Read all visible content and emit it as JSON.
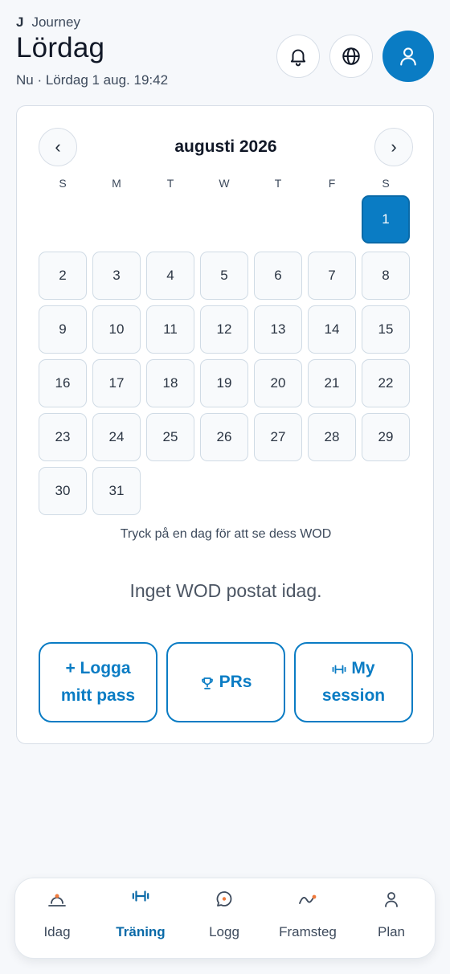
{
  "header": {
    "brand_mark": "J",
    "brand_name": "Journey",
    "title": "Lördag",
    "subtitle": "Nu · Lördag 1 aug. 19:42",
    "icons": {
      "notifications": "bell-icon",
      "language": "globe-icon",
      "profile": "user-icon"
    }
  },
  "calendar": {
    "month_label": "augusti 2026",
    "prev_label": "‹",
    "next_label": "›",
    "weekdays": [
      "S",
      "M",
      "T",
      "W",
      "T",
      "F",
      "S"
    ],
    "days": [
      "1",
      "2",
      "3",
      "4",
      "5",
      "6",
      "7",
      "8",
      "9",
      "10",
      "11",
      "12",
      "13",
      "14",
      "15",
      "16",
      "17",
      "18",
      "19",
      "20",
      "21",
      "22",
      "23",
      "24",
      "25",
      "26",
      "27",
      "28",
      "29",
      "30",
      "31"
    ],
    "selected_day": "1",
    "hint": "Tryck på en dag för att se dess WOD"
  },
  "wod": {
    "empty_message": "Inget WOD postat idag."
  },
  "actions": {
    "log_line1": "+ Logga",
    "log_line2": "mitt pass",
    "prs": "PRs",
    "session_line1": "My",
    "session_line2": "session",
    "accent_color": "#0a7cc4"
  },
  "tabbar": {
    "tabs": [
      {
        "label": "Idag",
        "icon": "sunrise-icon"
      },
      {
        "label": "Träning",
        "icon": "dumbbell-icon"
      },
      {
        "label": "Logg",
        "icon": "chat-bubble-icon"
      },
      {
        "label": "Framsteg",
        "icon": "trend-line-icon"
      },
      {
        "label": "Plan",
        "icon": "user-icon"
      }
    ],
    "active": "Träning"
  }
}
